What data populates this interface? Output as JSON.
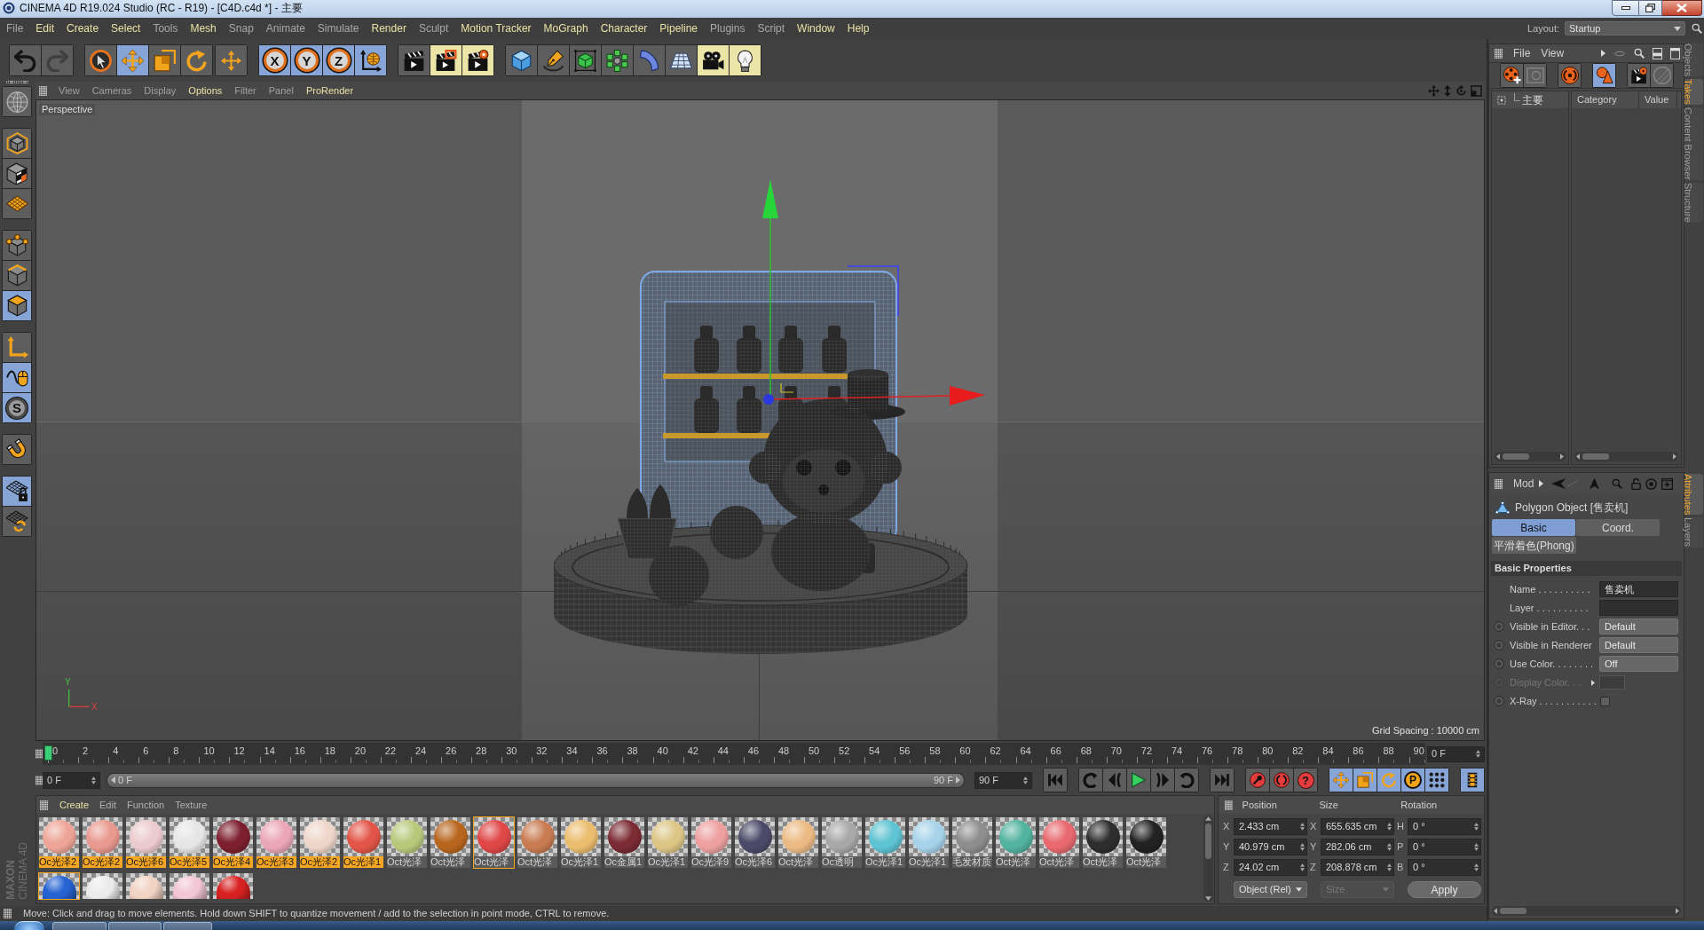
{
  "window": {
    "title": "CINEMA 4D R19.024 Studio (RC - R19) - [C4D.c4d *] - 主要"
  },
  "menu_bar": {
    "items": [
      {
        "label": "File",
        "highlighted": false
      },
      {
        "label": "Edit",
        "highlighted": true
      },
      {
        "label": "Create",
        "highlighted": true
      },
      {
        "label": "Select",
        "highlighted": true
      },
      {
        "label": "Tools",
        "highlighted": false
      },
      {
        "label": "Mesh",
        "highlighted": true
      },
      {
        "label": "Snap",
        "highlighted": false
      },
      {
        "label": "Animate",
        "highlighted": false
      },
      {
        "label": "Simulate",
        "highlighted": false
      },
      {
        "label": "Render",
        "highlighted": true
      },
      {
        "label": "Sculpt",
        "highlighted": false
      },
      {
        "label": "Motion Tracker",
        "highlighted": true
      },
      {
        "label": "MoGraph",
        "highlighted": true
      },
      {
        "label": "Character",
        "highlighted": true
      },
      {
        "label": "Pipeline",
        "highlighted": true
      },
      {
        "label": "Plugins",
        "highlighted": false
      },
      {
        "label": "Script",
        "highlighted": false
      },
      {
        "label": "Window",
        "highlighted": true
      },
      {
        "label": "Help",
        "highlighted": true
      }
    ],
    "layout_label": "Layout:",
    "layout_value": "Startup"
  },
  "toolbar": [
    {
      "buttons": [
        {
          "kind": "undo",
          "disabled": false
        },
        {
          "kind": "redo",
          "disabled": true
        }
      ]
    },
    {
      "buttons": [
        {
          "kind": "select",
          "selected": false
        },
        {
          "kind": "move",
          "selected": true
        },
        {
          "kind": "scale",
          "selected": false
        },
        {
          "kind": "rotate",
          "selected": false
        }
      ]
    },
    {
      "buttons": [
        {
          "kind": "transform",
          "selected": false
        }
      ]
    },
    {
      "buttons": [
        {
          "kind": "axis",
          "label": "X",
          "selected": true
        },
        {
          "kind": "axis",
          "label": "Y",
          "selected": true
        },
        {
          "kind": "axis",
          "label": "Z",
          "selected": true
        },
        {
          "kind": "coords",
          "selected": true
        }
      ]
    },
    {
      "buttons": [
        {
          "kind": "renderview",
          "highlighted": false
        },
        {
          "kind": "renderpicture",
          "highlighted": true
        },
        {
          "kind": "rendersettings",
          "highlighted": true
        }
      ]
    },
    {
      "buttons": [
        {
          "kind": "cube",
          "highlighted": false
        },
        {
          "kind": "pen",
          "highlighted": false
        },
        {
          "kind": "subdivision",
          "highlighted": false
        },
        {
          "kind": "cloner",
          "highlighted": false
        },
        {
          "kind": "deformer",
          "highlighted": false
        },
        {
          "kind": "floor",
          "highlighted": false
        },
        {
          "kind": "camera",
          "highlighted": true
        },
        {
          "kind": "light",
          "highlighted": true
        }
      ]
    }
  ],
  "left_toolbar": [
    {
      "buttons": [
        {
          "kind": "globe"
        }
      ]
    },
    {
      "buttons": [
        {
          "kind": "model",
          "selected": false
        },
        {
          "kind": "texture",
          "selected": false
        },
        {
          "kind": "workplane",
          "selected": false
        }
      ]
    },
    {
      "buttons": [
        {
          "kind": "points",
          "selected": false
        },
        {
          "kind": "edges",
          "selected": false
        },
        {
          "kind": "polygons",
          "selected": true
        }
      ]
    },
    {
      "buttons": [
        {
          "kind": "objectaxis",
          "selected": false
        },
        {
          "kind": "tweak",
          "selected": true
        },
        {
          "kind": "snap",
          "label": "S",
          "selected": true
        }
      ]
    },
    {
      "buttons": [
        {
          "kind": "magnet",
          "selected": false
        }
      ]
    },
    {
      "buttons": [
        {
          "kind": "gridlock",
          "selected": true
        },
        {
          "kind": "gridrotate",
          "selected": false
        }
      ]
    }
  ],
  "viewport": {
    "menu": [
      {
        "label": "View",
        "highlighted": false
      },
      {
        "label": "Cameras",
        "highlighted": false
      },
      {
        "label": "Display",
        "highlighted": false
      },
      {
        "label": "Options",
        "highlighted": true
      },
      {
        "label": "Filter",
        "highlighted": false
      },
      {
        "label": "Panel",
        "highlighted": false
      },
      {
        "label": "ProRender",
        "highlighted": true
      }
    ],
    "camera": "Perspective",
    "axis_y": "Y",
    "axis_x": "X",
    "grid_spacing": "Grid Spacing : 10000 cm"
  },
  "timeline": {
    "frames": [
      "0",
      "2",
      "4",
      "6",
      "8",
      "10",
      "12",
      "14",
      "16",
      "18",
      "20",
      "22",
      "24",
      "26",
      "28",
      "30",
      "32",
      "34",
      "36",
      "38",
      "40",
      "42",
      "44",
      "46",
      "48",
      "50",
      "52",
      "54",
      "56",
      "58",
      "60",
      "62",
      "64",
      "66",
      "68",
      "70",
      "72",
      "74",
      "76",
      "78",
      "80",
      "82",
      "84",
      "86",
      "88",
      "90"
    ],
    "playhead": {
      "level": 0
    },
    "current_frame": "0 F",
    "start_frame": "0 F",
    "range_slider": {
      "start": "0 F",
      "end": "90 F",
      "level": 1
    },
    "end_frame": "90 F",
    "controls": [
      {
        "buttons": [
          {
            "kind": "gostart"
          }
        ]
      },
      {
        "buttons": [
          {
            "kind": "prevkey"
          },
          {
            "kind": "prevframe"
          },
          {
            "kind": "play"
          },
          {
            "kind": "nextframe"
          },
          {
            "kind": "nextkey"
          }
        ]
      },
      {
        "buttons": [
          {
            "kind": "goend"
          }
        ]
      },
      {
        "buttons": [
          {
            "kind": "recordkey"
          },
          {
            "kind": "autokey"
          },
          {
            "kind": "keyselection",
            "label": "?"
          }
        ]
      },
      {
        "buttons": [
          {
            "kind": "keymove",
            "selected": true
          },
          {
            "kind": "keyscale",
            "selected": true
          },
          {
            "kind": "keyrotate",
            "selected": true
          },
          {
            "kind": "param",
            "label": "P",
            "selected": true
          },
          {
            "kind": "pointlevel",
            "selected": true
          }
        ]
      },
      {
        "buttons": [
          {
            "kind": "timeline",
            "selected": true
          }
        ]
      }
    ]
  },
  "materials": {
    "menu": [
      {
        "label": "Create",
        "highlighted": true
      },
      {
        "label": "Edit",
        "highlighted": false
      },
      {
        "label": "Function",
        "highlighted": false
      },
      {
        "label": "Texture",
        "highlighted": false
      }
    ],
    "rows": [
      [
        {
          "label": "Oc光泽2",
          "color": "#eea597",
          "selected": true,
          "active": false
        },
        {
          "label": "Oc光泽2",
          "color": "#e9998f",
          "selected": true,
          "active": false
        },
        {
          "label": "Oc光泽6",
          "color": "#eccbcf",
          "selected": true,
          "active": false
        },
        {
          "label": "Oc光泽5",
          "color": "#e6e6e6",
          "selected": true,
          "active": false
        },
        {
          "label": "Oc光泽4",
          "color": "#7d1f2e",
          "selected": true,
          "active": false
        },
        {
          "label": "Oc光泽3",
          "color": "#eba6b8",
          "selected": true,
          "active": false
        },
        {
          "label": "Oc光泽2",
          "color": "#efd6ca",
          "selected": true,
          "active": false
        },
        {
          "label": "Oc光泽1",
          "color": "#e35548",
          "selected": true,
          "active": false
        },
        {
          "label": "Oct光泽",
          "color": "#b9c97c",
          "selected": false,
          "active": false
        },
        {
          "label": "Oct光泽",
          "color": "#b8661e",
          "selected": false,
          "active": false
        },
        {
          "label": "Oct光泽",
          "color": "#e04747",
          "selected": false,
          "active": true
        },
        {
          "label": "Oct光泽",
          "color": "#c97c52",
          "selected": false,
          "active": false
        },
        {
          "label": "Oc光泽1",
          "color": "#ebbd6e",
          "selected": false,
          "active": false
        },
        {
          "label": "Oc金属1",
          "color": "#7b2b33",
          "selected": false,
          "active": false
        },
        {
          "label": "Oc光泽1",
          "color": "#dcc585",
          "selected": false,
          "active": false
        },
        {
          "label": "Oc光泽9",
          "color": "#eea0a0",
          "selected": false,
          "active": false
        },
        {
          "label": "Oc光泽6",
          "color": "#4c4a68",
          "selected": false,
          "active": false
        },
        {
          "label": "Oct光泽",
          "color": "#ecbb85",
          "selected": false,
          "active": false
        },
        {
          "label": "Oc透明",
          "color": "#a8a8a8",
          "selected": false,
          "active": false
        },
        {
          "label": "Oc光泽1",
          "color": "#5ec3d2",
          "selected": false,
          "active": false
        },
        {
          "label": "Oc光泽1",
          "color": "#a6d3ea",
          "selected": false,
          "active": false
        },
        {
          "label": "毛发材质",
          "color": "#8e8e8e",
          "selected": false,
          "active": false
        },
        {
          "label": "Oct光泽",
          "color": "#52b39f",
          "selected": false,
          "active": false
        },
        {
          "label": "Oct光泽",
          "color": "#e8696f",
          "selected": false,
          "active": false
        },
        {
          "label": "Oct光泽",
          "color": "#2e2e2e",
          "selected": false,
          "active": false
        },
        {
          "label": "Oct光泽",
          "color": "#222222",
          "selected": false,
          "active": false
        }
      ],
      [
        {
          "color": "#2563d3",
          "active": true
        },
        {
          "color": "#ebebeb",
          "active": false
        },
        {
          "color": "#f2d3c4",
          "active": false
        },
        {
          "color": "#f2c6d4",
          "active": false
        },
        {
          "color": "#d82222",
          "active": false
        }
      ]
    ]
  },
  "coordinates": {
    "headers": [
      "Position",
      "Size",
      "Rotation"
    ],
    "rows": [
      [
        {
          "axis": "X",
          "value": "2.433 cm"
        },
        {
          "axis": "X",
          "value": "655.635 cm"
        },
        {
          "axis": "H",
          "value": "0 °"
        }
      ],
      [
        {
          "axis": "Y",
          "value": "40.979 cm"
        },
        {
          "axis": "Y",
          "value": "282.06 cm"
        },
        {
          "axis": "P",
          "value": "0 °"
        }
      ],
      [
        {
          "axis": "Z",
          "value": "24.02 cm"
        },
        {
          "axis": "Z",
          "value": "208.878 cm"
        },
        {
          "axis": "B",
          "value": "0 °"
        }
      ]
    ],
    "mode": "Object (Rel)",
    "size_mode": {
      "label": "Size",
      "disabled": true
    },
    "apply": "Apply"
  },
  "status_bar": {
    "text": "Move: Click and drag to move elements. Hold down SHIFT to quantize movement / add to the selection in point mode, CTRL to remove."
  },
  "logo": {
    "brand": "MAXON",
    "product": "CINEMA 4D"
  },
  "takes": {
    "menu": [
      "File",
      "View"
    ],
    "tools": [
      {
        "buttons": [
          {
            "kind": "takeadd",
            "selected": false,
            "disabled": false
          },
          {
            "kind": "takefolder",
            "selected": false,
            "disabled": true
          }
        ]
      },
      {
        "buttons": [
          {
            "kind": "override",
            "selected": false,
            "disabled": false
          }
        ]
      },
      {
        "buttons": [
          {
            "kind": "autotake",
            "selected": true,
            "disabled": false
          }
        ]
      },
      {
        "buttons": [
          {
            "kind": "takerender",
            "selected": false,
            "disabled": false
          },
          {
            "kind": "takerenderall",
            "selected": false,
            "disabled": true
          }
        ]
      }
    ],
    "tree": [
      {
        "label": "主要"
      }
    ],
    "columns": [
      "Category",
      "Value"
    ]
  },
  "attributes": {
    "menu": "Mod",
    "title": "Polygon Object [售卖机]",
    "tabs": [
      {
        "label": "Basic",
        "selected": true
      },
      {
        "label": "Coord.",
        "selected": false
      },
      {
        "label": "平滑着色(Phong)",
        "selected": false
      }
    ],
    "section": "Basic Properties",
    "fields": [
      {
        "kind": "text",
        "label": "Name . . . . . . . . . .",
        "value": "售卖机",
        "animatable": false,
        "disabled": false
      },
      {
        "kind": "link",
        "label": "Layer . . . . . . . . . .",
        "animatable": false,
        "disabled": false
      },
      {
        "kind": "dropdown",
        "label": "Visible in Editor. . .",
        "value": "Default",
        "animatable": true,
        "disabled": false
      },
      {
        "kind": "dropdown",
        "label": "Visible in Renderer",
        "value": "Default",
        "animatable": true,
        "disabled": false
      },
      {
        "kind": "dropdown",
        "label": "Use Color. . . . . . . .",
        "value": "Off",
        "animatable": true,
        "disabled": false
      },
      {
        "kind": "color",
        "label": "Display Color. . .",
        "animatable": true,
        "disabled": true
      },
      {
        "kind": "checkbox",
        "label": "X-Ray . . . . . . . . . . .",
        "checked": false,
        "animatable": true,
        "disabled": false
      }
    ]
  },
  "side_tabs": {
    "top": [
      {
        "label": "Objects",
        "selected": false
      },
      {
        "label": "Takes",
        "selected": true
      },
      {
        "label": "Content Browser",
        "selected": false
      },
      {
        "label": "Structure",
        "selected": false
      }
    ],
    "bottom": [
      {
        "label": "Attributes",
        "selected": true
      },
      {
        "label": "Layers",
        "selected": false
      }
    ]
  }
}
